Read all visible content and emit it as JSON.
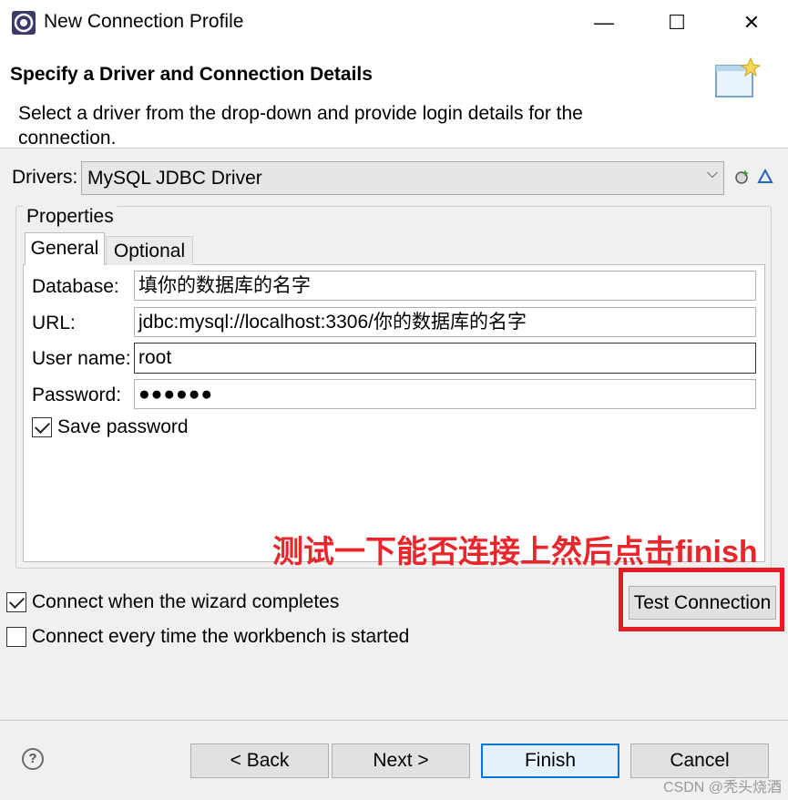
{
  "window": {
    "title": "New Connection Profile",
    "minimize_glyph": "—",
    "maximize_glyph": "☐",
    "close_glyph": "✕",
    "app_icon": "eclipse-icon"
  },
  "header": {
    "title": "Specify a Driver and Connection Details",
    "description": "Select a driver from the drop-down and provide login details for the connection."
  },
  "drivers": {
    "label": "Drivers:",
    "selected": "MySQL JDBC Driver",
    "chevron": "⌵"
  },
  "properties": {
    "label": "Properties",
    "tabs": [
      {
        "label": "General",
        "active": true
      },
      {
        "label": "Optional",
        "active": false
      }
    ],
    "fields": {
      "database": {
        "label": "Database:",
        "value": "填你的数据库的名字"
      },
      "url": {
        "label": "URL:",
        "value": "jdbc:mysql://localhost:3306/你的数据库的名字"
      },
      "username": {
        "label": "User name:",
        "value": "root"
      },
      "password": {
        "label": "Password:",
        "value": "●●●●●●"
      }
    },
    "save_password": {
      "label": "Save password",
      "checked": true
    }
  },
  "annotation": {
    "text": "测试一下能否连接上然后点击finish",
    "color": "#e8262b"
  },
  "options": {
    "connect_on_complete": {
      "label": "Connect when the wizard completes",
      "checked": true
    },
    "connect_on_startup": {
      "label": "Connect every time the workbench is started",
      "checked": false
    }
  },
  "test_connection": {
    "label": "Test Connection",
    "highlight_color": "#e51b23"
  },
  "footer": {
    "help_glyph": "?",
    "back": "< Back",
    "next": "Next >",
    "finish": "Finish",
    "cancel": "Cancel"
  },
  "watermark": "CSDN @秃头烧酒"
}
